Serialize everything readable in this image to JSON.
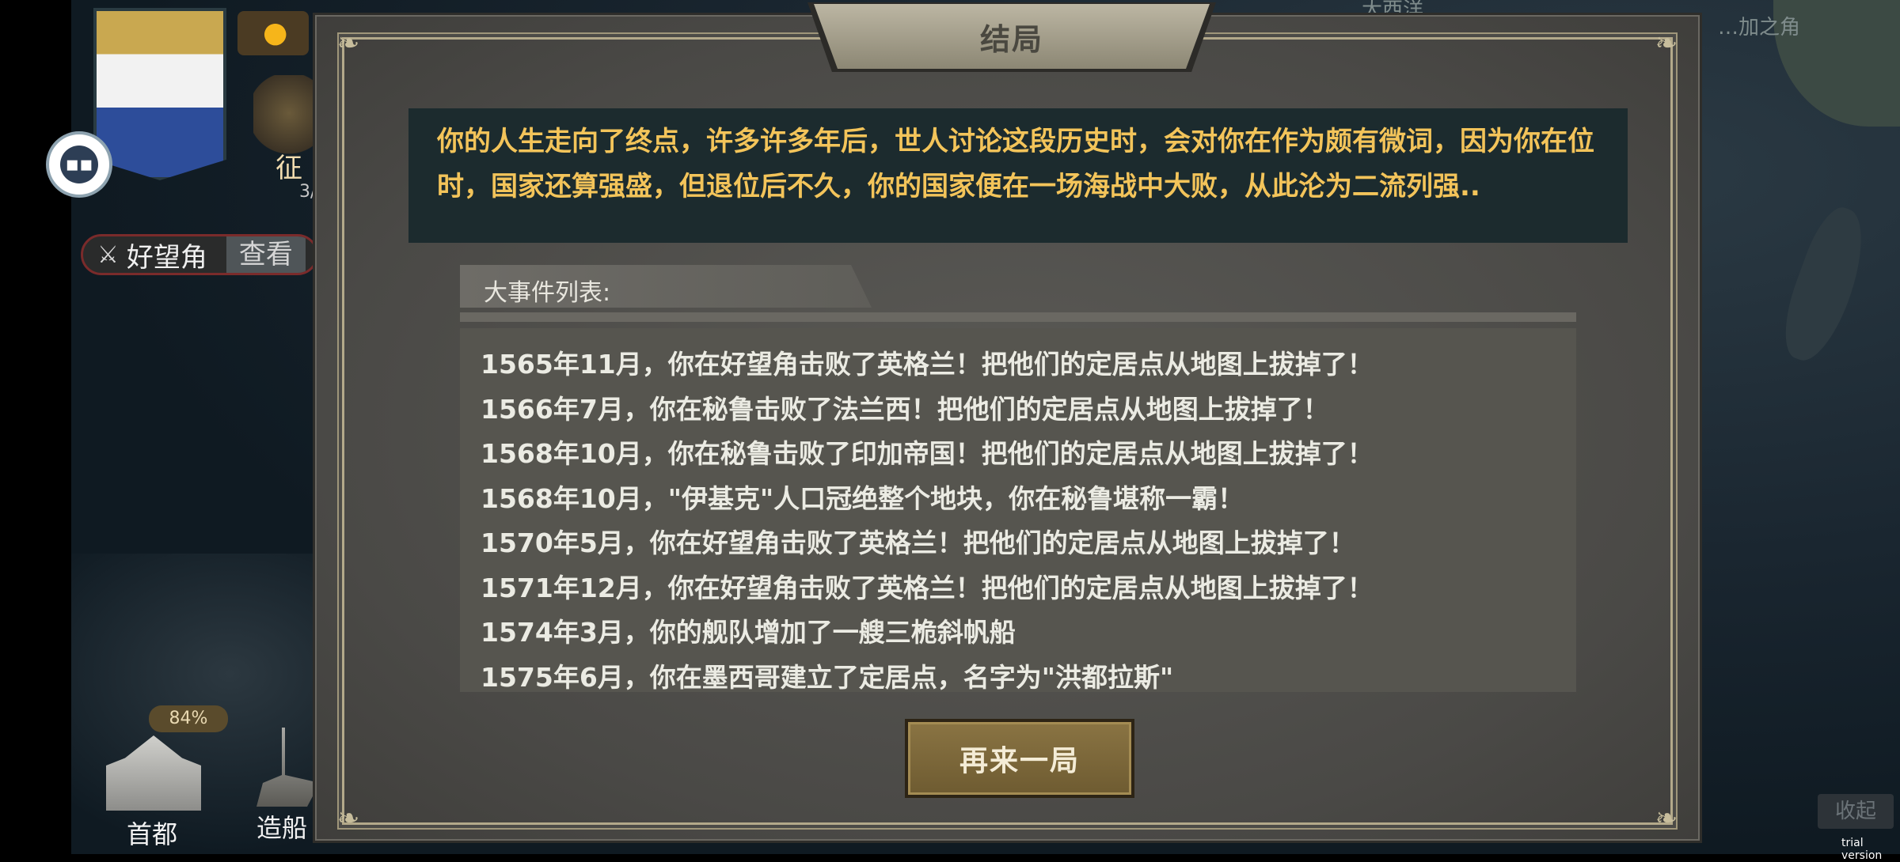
{
  "map": {
    "label_top_right": "…加之角",
    "label_top": "大西洋"
  },
  "hud": {
    "conquest_label": "征",
    "conquest_count": "3/",
    "location_name": "好望角",
    "view_label": "查看",
    "capital_percent": "84%",
    "capital_label": "首都",
    "ship_label": "造船",
    "collapse_label": "收起",
    "trial_label": "trial version"
  },
  "modal": {
    "title": "结局",
    "epitaph": "你的人生走向了终点，许多许多年后，世人讨论这段历史时，会对你在作为颇有微词，因为你在位时，国家还算强盛，但退位后不久，你的国家便在一场海战中大败，从此沦为二流列强..",
    "events_header": "大事件列表:",
    "events": [
      "1565年11月，你在好望角击败了英格兰！把他们的定居点从地图上拔掉了！",
      "1566年7月，你在秘鲁击败了法兰西！把他们的定居点从地图上拔掉了！",
      "1568年10月，你在秘鲁击败了印加帝国！把他们的定居点从地图上拔掉了！",
      "1568年10月，\"伊基克\"人口冠绝整个地块，你在秘鲁堪称一霸！",
      "1570年5月，你在好望角击败了英格兰！把他们的定居点从地图上拔掉了！",
      "1571年12月，你在好望角击败了英格兰！把他们的定居点从地图上拔掉了！",
      "1574年3月，你的舰队增加了一艘三桅斜帆船",
      "1575年6月，你在墨西哥建立了定居点，名字为\"洪都拉斯\""
    ],
    "restart_label": "再来一局"
  },
  "colors": {
    "epitaph_text": "#f3c45a",
    "button_gold": "#8a7443",
    "panel": "#4a4946"
  }
}
